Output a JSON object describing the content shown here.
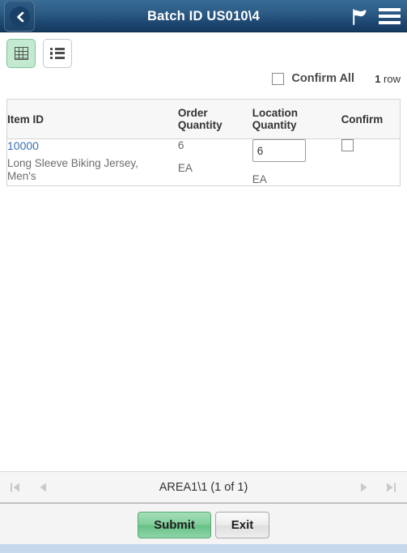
{
  "header": {
    "title": "Batch ID US010\\4",
    "back_icon": "chevron-left-icon",
    "flag_icon": "flag-icon",
    "menu_icon": "hamburger-menu-icon"
  },
  "toolbar": {
    "grid_view_icon": "grid-view-icon",
    "list_view_icon": "list-view-icon",
    "selected_view": "grid"
  },
  "confirm_all": {
    "label": "Confirm All",
    "checked": false,
    "row_count_number": "1",
    "row_count_label": " row"
  },
  "table": {
    "columns": [
      {
        "label": "Item ID"
      },
      {
        "label": "Order Quantity"
      },
      {
        "label": "Location Quantity"
      },
      {
        "label": "Confirm"
      }
    ],
    "column_lines": {
      "order_line1": "Order",
      "order_line2": "Quantity",
      "location_line1": "Location",
      "location_line2": "Quantity"
    },
    "rows": [
      {
        "item_id": "10000",
        "description": "Long Sleeve Biking Jersey, Men's",
        "order_quantity": "6",
        "order_uom": "EA",
        "location_quantity": "6",
        "location_uom": "EA",
        "confirmed": false
      }
    ]
  },
  "pager": {
    "label": "AREA1\\1 (1 of 1)",
    "first_icon": "first-page-icon",
    "prev_icon": "previous-page-icon",
    "next_icon": "next-page-icon",
    "last_icon": "last-page-icon"
  },
  "footer": {
    "submit_label": "Submit",
    "exit_label": "Exit"
  },
  "colors": {
    "header_top": "#386c96",
    "header_bottom": "#143a5e",
    "selected_view_bg": "#c3ead0",
    "link": "#3a6fb5",
    "submit_green": "#7fcc9a",
    "footer_strip": "#c6d9ec"
  }
}
